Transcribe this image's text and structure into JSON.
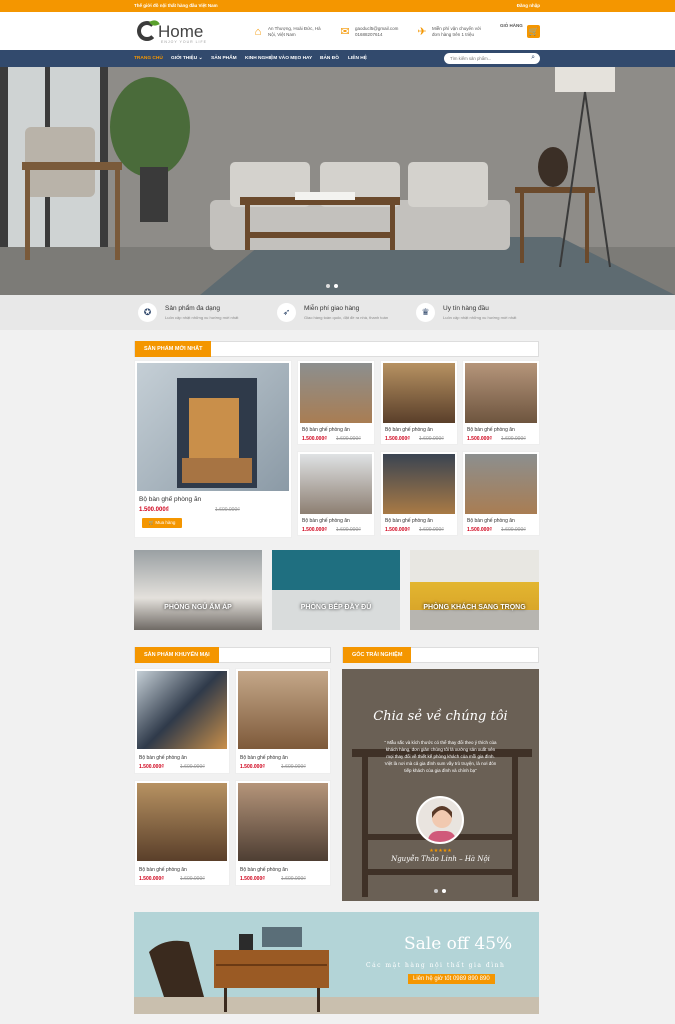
{
  "topbar": {
    "left": "Thế giới đồ nội thất hàng đầu Việt Nam",
    "right": "Đăng nhập"
  },
  "logo": {
    "name": "Home",
    "tagline": "ENJOY YOUR LIFE"
  },
  "header": {
    "address": [
      "An Thượng, Hoài Đức, Hà",
      "Nội, Việt Nam"
    ],
    "contact": [
      "gaoducl5@gmail.com",
      "01688207614"
    ],
    "shipping": [
      "Miễn phí vận chuyển với",
      "đơn hàng trên 1 triệu"
    ],
    "cart_label": "GIỎ HÀNG"
  },
  "nav": {
    "items": [
      "TRANG CHỦ",
      "GIỚI THIỆU",
      "SẢN PHẨM",
      "KINH NGHIỆM VÀO MẸO HAY",
      "BẢN ĐỒ",
      "LIÊN HỆ"
    ],
    "search_placeholder": "Tìm kiếm sản phẩm..."
  },
  "features": [
    {
      "title": "Sản phẩm đa dạng",
      "sub": "Luôn cập nhật những xu hướng mới nhất",
      "icon": "medal-icon"
    },
    {
      "title": "Miễn phí giao hàng",
      "sub": "Giao hàng toàn quốc, đặt đề ra nhà, thanh toán",
      "icon": "rocket-icon"
    },
    {
      "title": "Uy tín hàng đầu",
      "sub": "Luôn cập nhật những xu hướng mới nhất",
      "icon": "trophy-icon"
    }
  ],
  "sections": {
    "new": "SẢN PHẨM MỚI NHẤT",
    "promo": "SẢN PHẨM KHUYẾN MẠI",
    "exp": "GÓC TRẢI NGHIỆM"
  },
  "product": {
    "name": "Bộ bàn ghế phòng ăn",
    "price": "1.500.000₫",
    "old": "1.600.000₫",
    "buy": "Mua hàng"
  },
  "categories": [
    "PHÒNG NGỦ ẤM ÁP",
    "PHÒNG BẾP ĐẦY ĐỦ",
    "PHÒNG KHÁCH SANG TRỌNG"
  ],
  "testimonial": {
    "title": "Chia sẻ về chúng tôi",
    "quote": "\" Mẫu sắc và kích thước có thể thay đổi theo ý thích của khách hàng, đơn giản chúng tôi là xưởng sản xuất nên mọi thay đổi về thiết kế phòng khách của mỗi gia đình. Việt là nơi mà cả gia đình sum vầy trò truyện, là nơi đón tiếp khách của gia đình và chính bạ\"",
    "stars": "★★★★★",
    "author": "Nguyễn Thảo Linh – Hà Nội"
  },
  "banner": {
    "title": "Sale off 45%",
    "sub": "Các mặt hàng nội thất gia đình",
    "cta": "Liên hệ giờ tốt 0989 890 890"
  },
  "colors": {
    "accent": "#f49600",
    "nav": "#324a6d",
    "price": "#d0021b"
  }
}
